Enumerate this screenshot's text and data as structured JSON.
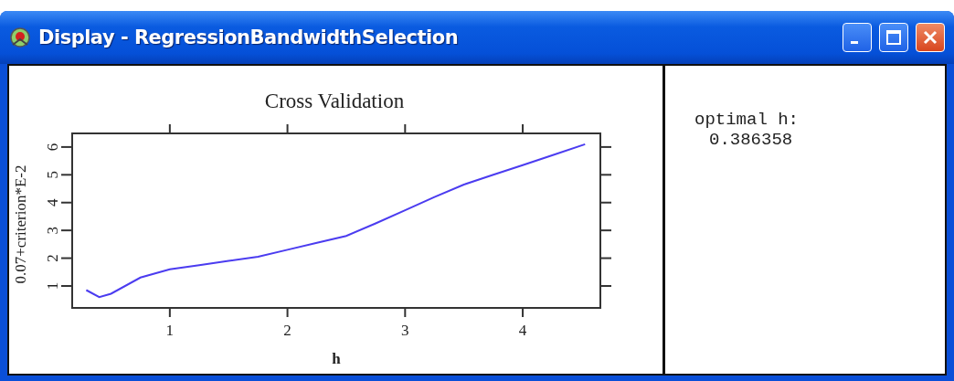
{
  "window": {
    "title": "Display - RegressionBandwidthSelection"
  },
  "plot_panel": {
    "chart_data": {
      "type": "line",
      "title": "Cross Validation",
      "xlabel": "h",
      "ylabel": "0.07+criterion*E-2",
      "xlim": [
        0.17,
        4.66
      ],
      "ylim": [
        0.21,
        6.49
      ],
      "xticks": [
        1,
        2,
        3,
        4
      ],
      "yticks": [
        1,
        2,
        3,
        4,
        5,
        6
      ],
      "x": [
        0.29,
        0.4,
        0.5,
        0.75,
        1,
        1.25,
        1.5,
        1.75,
        2,
        2.25,
        2.5,
        2.75,
        3,
        3.25,
        3.5,
        3.75,
        4,
        4.25,
        4.53
      ],
      "series": [
        {
          "color": "#4b3cf0",
          "values": [
            0.85,
            0.6,
            0.72,
            1.3,
            1.6,
            1.75,
            1.9,
            2.05,
            2.3,
            2.55,
            2.8,
            3.25,
            3.72,
            4.2,
            4.65,
            5.0,
            5.35,
            5.7,
            6.1
          ]
        }
      ]
    }
  },
  "result_panel": {
    "label": "optimal h:",
    "value": "0.386358"
  }
}
